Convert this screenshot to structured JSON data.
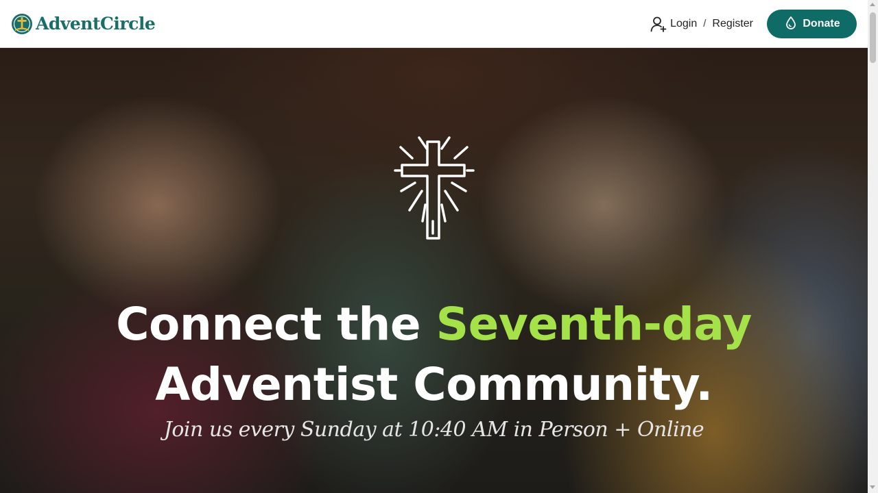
{
  "brand": {
    "name": "AdventCircle",
    "logo_icon": "advent-circle-logo-icon",
    "color": "#1a6e68"
  },
  "nav": {
    "login_label": "Login",
    "separator": "/",
    "register_label": "Register",
    "login_icon": "user-plus-icon",
    "donate_label": "Donate",
    "donate_icon": "drop-icon",
    "donate_color": "#0e6b66"
  },
  "hero": {
    "icon": "radiant-cross-icon",
    "title_part1": "Connect the ",
    "title_accent": "Seventh-day",
    "title_part2": "Adventist Community.",
    "accent_color": "#a5e24a",
    "subtitle": "Join us every Sunday at 10:40 AM in Person + Online"
  }
}
